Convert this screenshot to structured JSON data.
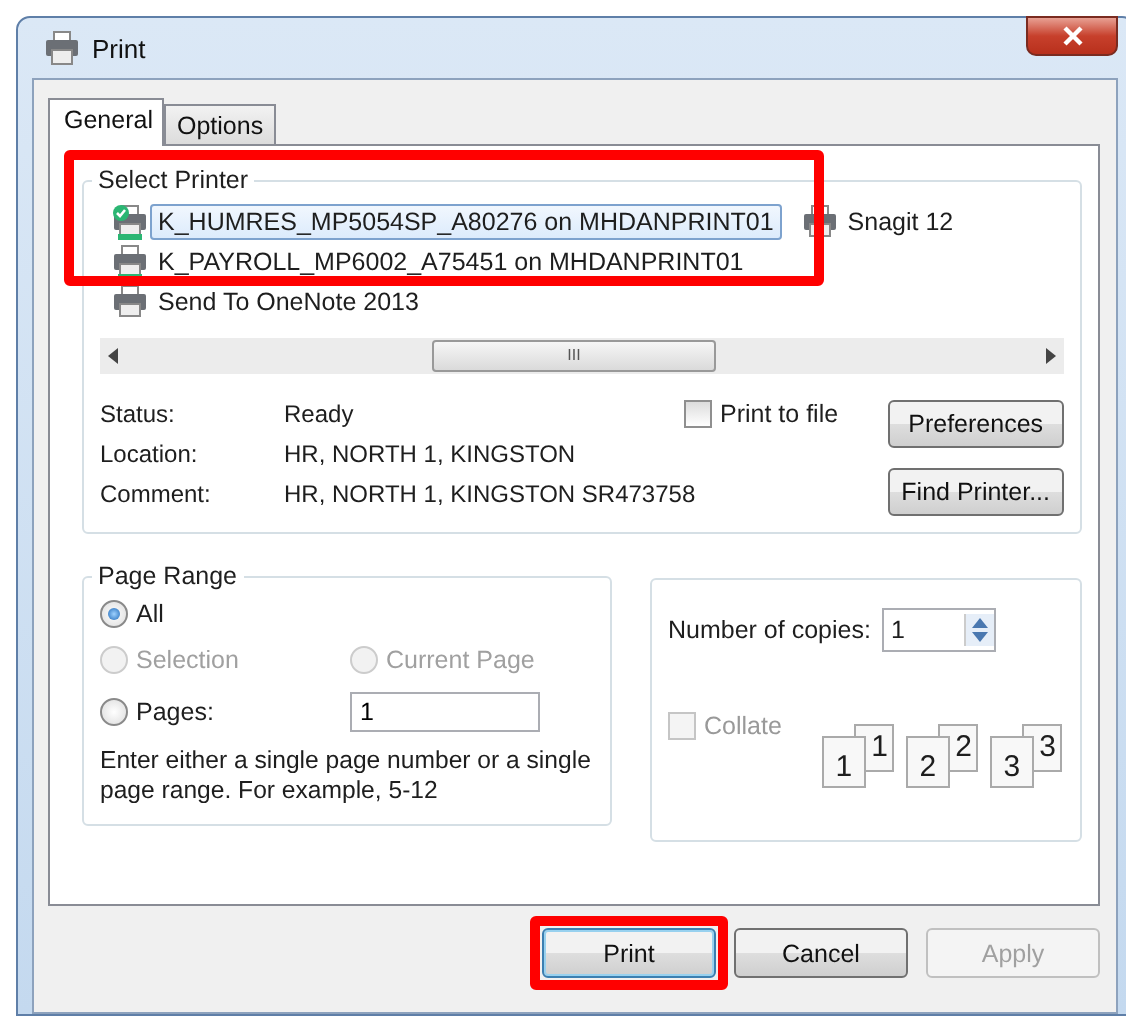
{
  "window": {
    "title": "Print"
  },
  "tabs": [
    {
      "label": "General",
      "selected": true
    },
    {
      "label": "Options",
      "selected": false
    }
  ],
  "select_printer": {
    "label": "Select Printer",
    "highlighted": true,
    "printers": [
      {
        "name": "K_HUMRES_MP5054SP_A80276 on MHDANPRINT01",
        "selected": true,
        "default": true,
        "network": true
      },
      {
        "name": "K_PAYROLL_MP6002_A75451 on MHDANPRINT01",
        "selected": false,
        "default": false,
        "network": true
      },
      {
        "name": "Send To OneNote 2013",
        "selected": false,
        "default": false,
        "network": false
      },
      {
        "name": "Snagit 12",
        "selected": false,
        "default": false,
        "network": false
      }
    ],
    "scrollbar_grip": "III",
    "info": [
      {
        "label": "Status:",
        "value": "Ready"
      },
      {
        "label": "Location:",
        "value": "HR, NORTH 1, KINGSTON"
      },
      {
        "label": "Comment:",
        "value": "HR, NORTH 1, KINGSTON  SR473758"
      }
    ],
    "print_to_file": {
      "label": "Print to file",
      "checked": false
    },
    "buttons": [
      "Preferences",
      "Find Printer..."
    ]
  },
  "page_range": {
    "label": "Page Range",
    "options": [
      {
        "label": "All",
        "selected": true,
        "disabled": false
      },
      {
        "label": "Selection",
        "selected": false,
        "disabled": true
      },
      {
        "label": "Current Page",
        "selected": false,
        "disabled": true
      },
      {
        "label": "Pages:",
        "selected": false,
        "disabled": false
      }
    ],
    "pages_value": "1",
    "hint": "Enter either a single page number or a single page range.  For example, 5-12"
  },
  "copies": {
    "label": "Number of copies:",
    "value": "1",
    "collate": {
      "label": "Collate",
      "checked": false,
      "disabled": true
    },
    "stacks": [
      {
        "back": "1",
        "front": "1"
      },
      {
        "back": "2",
        "front": "2"
      },
      {
        "back": "3",
        "front": "3"
      }
    ]
  },
  "buttons": [
    {
      "label": "Print",
      "disabled": false,
      "highlighted": true
    },
    {
      "label": "Cancel",
      "disabled": false,
      "highlighted": false
    },
    {
      "label": "Apply",
      "disabled": true,
      "highlighted": false
    }
  ]
}
